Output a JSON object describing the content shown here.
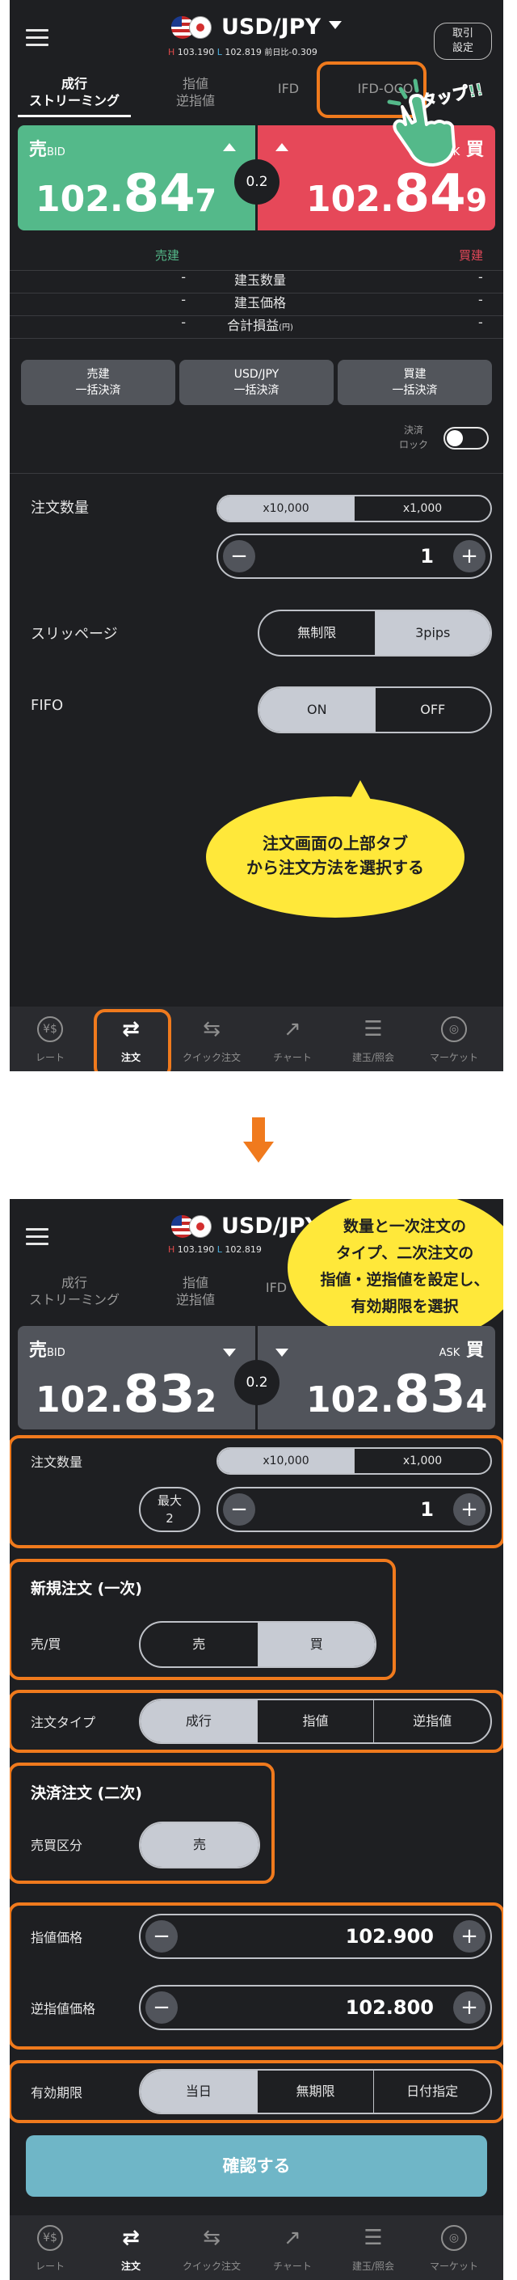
{
  "header": {
    "pair": "USD/JPY",
    "high_prefix": "H",
    "high": "103.190",
    "low_prefix": "L",
    "low": "102.819",
    "change_label": "前日比",
    "change": "-0.309",
    "settings_line1": "取引",
    "settings_line2": "設定"
  },
  "screen1": {
    "tabs": [
      {
        "line1": "成行",
        "line2": "ストリーミング"
      },
      {
        "line1": "指値",
        "line2": "逆指値"
      },
      {
        "line1": "IFD"
      },
      {
        "line1": "IFD-OCO"
      }
    ],
    "sell": {
      "label": "売",
      "sub": "BID",
      "p1": "102.",
      "p2": "84",
      "p3": "7"
    },
    "buy": {
      "label": "買",
      "sub": "ASK",
      "p1": "102.",
      "p2": "84",
      "p3": "9"
    },
    "spread": "0.2",
    "positions": {
      "sell_header": "売建",
      "buy_header": "買建",
      "rows": [
        {
          "label": "建玉数量",
          "left": "-",
          "right": "-"
        },
        {
          "label": "建玉価格",
          "left": "-",
          "right": "-"
        },
        {
          "label": "合計損益",
          "unit": "(円)",
          "left": "-",
          "right": "-"
        }
      ]
    },
    "close_buttons": [
      {
        "line1": "売建",
        "line2": "一括決済"
      },
      {
        "line1": "USD/JPY",
        "line2": "一括決済"
      },
      {
        "line1": "買建",
        "line2": "一括決済"
      }
    ],
    "lock": {
      "line1": "決済",
      "line2": "ロック"
    },
    "order_qty_label": "注文数量",
    "qty_units": [
      "x10,000",
      "x1,000"
    ],
    "qty_value": "1",
    "slippage_label": "スリッページ",
    "slippage_options": [
      "無制限",
      "3pips"
    ],
    "fifo_label": "FIFO",
    "fifo_options": [
      "ON",
      "OFF"
    ],
    "bubble_line1": "注文画面の上部タブ",
    "bubble_line2": "から注文方法を選択する",
    "tap_label": "タップ!!"
  },
  "screen2": {
    "tabs": [
      {
        "line1": "成行",
        "line2": "ストリーミング"
      },
      {
        "line1": "指値",
        "line2": "逆指値"
      },
      {
        "line1": "IFD"
      }
    ],
    "sell": {
      "label": "売",
      "sub": "BID",
      "p1": "102.",
      "p2": "83",
      "p3": "2"
    },
    "buy": {
      "label": "買",
      "sub": "ASK",
      "p1": "102.",
      "p2": "83",
      "p3": "4"
    },
    "spread": "0.2",
    "bubble_lines": [
      "数量と一次注文の",
      "タイプ、二次注文の",
      "指値・逆指値を設定し、",
      "有効期限を選択"
    ],
    "order_qty_label": "注文数量",
    "qty_units": [
      "x10,000",
      "x1,000"
    ],
    "max_line1": "最大",
    "max_line2": "2",
    "qty_value": "1",
    "first_order_title": "新規注文 (一次)",
    "side_label": "売/買",
    "side_options": [
      "売",
      "買"
    ],
    "order_type_label": "注文タイプ",
    "order_type_options": [
      "成行",
      "指値",
      "逆指値"
    ],
    "second_order_title": "決済注文 (二次)",
    "settle_side_label": "売買区分",
    "settle_side_value": "売",
    "limit_label": "指値価格",
    "limit_value": "102.900",
    "stop_label": "逆指値価格",
    "stop_value": "102.800",
    "expiry_label": "有効期限",
    "expiry_options": [
      "当日",
      "無期限",
      "日付指定"
    ],
    "confirm_label": "確認する"
  },
  "nav": [
    {
      "label": "レート",
      "icon": "yen-dollar-icon"
    },
    {
      "label": "注文",
      "icon": "order-arrows-icon"
    },
    {
      "label": "クイック注文",
      "icon": "quick-order-icon"
    },
    {
      "label": "チャート",
      "icon": "chart-icon"
    },
    {
      "label": "建玉/照会",
      "icon": "list-icon"
    },
    {
      "label": "マーケット",
      "icon": "globe-icon"
    }
  ],
  "colors": {
    "sell": "#54b98a",
    "buy": "#e64859",
    "accent": "#f07a1d",
    "bubble": "#ffe83a"
  }
}
